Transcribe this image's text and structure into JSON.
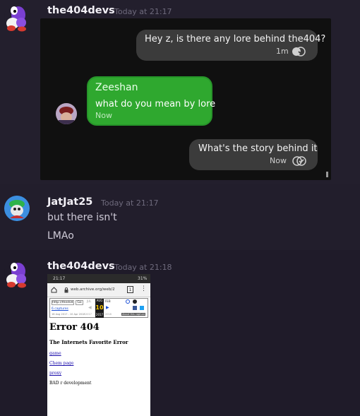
{
  "messages": [
    {
      "author": "the404devs",
      "time": "Today at 21:17"
    },
    {
      "author": "JatJat25",
      "time": "Today at 21:17",
      "lines": [
        "but there isn't",
        "LMAo"
      ]
    },
    {
      "author": "the404devs",
      "time": "Today at 21:18"
    }
  ],
  "embed_chat": {
    "bubble1": {
      "text": "Hey z, is there any lore behind the404?",
      "meta": "1m"
    },
    "bubble2": {
      "name": "Zeeshan",
      "text": "what do you mean by lore",
      "meta": "Now"
    },
    "bubble3": {
      "text": "What's the story behind it",
      "meta": "Now"
    }
  },
  "screenshot": {
    "status_time": "21:17",
    "status_right": "31%",
    "url": "web.archive.org/web/2",
    "tab_count": "1",
    "wayback_input": "http://the404",
    "go": "Go",
    "captures": "6 captures",
    "month_prev": "JUL",
    "month_cur": "AUG",
    "month_next": "FEB",
    "day": "10",
    "year_prev": "2017",
    "year_cur": "2017",
    "year_next": "2018",
    "capture_range": "16 Aug 2017 - 10 Apr 2018",
    "about": "About this capture",
    "h1": "Error 404",
    "h3": "The Internets Favorite Error",
    "links": [
      "game",
      "Chem page",
      "proxy"
    ],
    "plain": "BAD r development"
  },
  "colors": {
    "background": "#221e2c",
    "username": "#f2f0f6",
    "timestamp": "#6e6a7c",
    "gray_bubble": "#3b3b3b",
    "green_bubble": "#2fa82f"
  }
}
